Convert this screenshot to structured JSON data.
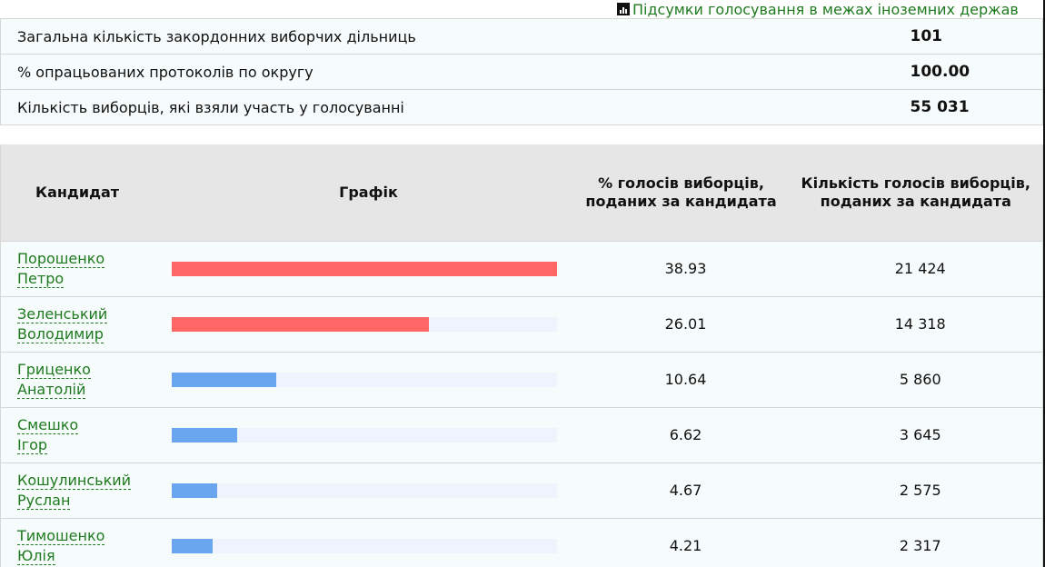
{
  "top_link": {
    "icon": "bar-chart-icon",
    "text": "Підсумки голосування в межах іноземних держав"
  },
  "summary": [
    {
      "label": "Загальна кількість закордонних виборчих дільниць",
      "value": "101"
    },
    {
      "label": "% опрацьованих протоколів по округу",
      "value": "100.00"
    },
    {
      "label": "Кількість виборців, які взяли участь у голосуванні",
      "value": "55 031"
    }
  ],
  "results": {
    "headers": {
      "candidate": "Кандидат",
      "chart": "Графік",
      "percent": "% голосів виборців, поданих за кандидата",
      "count": "Кількість голосів виборців, поданих за кандидата"
    },
    "colors": {
      "top": "#ff6666",
      "other": "#6aa6f0",
      "track": "#eef3fd"
    },
    "rows": [
      {
        "name_line1": "Порошенко",
        "name_line2": "Петро",
        "percent": "38.93",
        "count": "21 424",
        "bar_fraction": 1.0,
        "color": "top"
      },
      {
        "name_line1": "Зеленський",
        "name_line2": "Володимир",
        "percent": "26.01",
        "count": "14 318",
        "bar_fraction": 0.668,
        "color": "top"
      },
      {
        "name_line1": "Гриценко",
        "name_line2": "Анатолій",
        "percent": "10.64",
        "count": "5 860",
        "bar_fraction": 0.273,
        "color": "other"
      },
      {
        "name_line1": "Смешко",
        "name_line2": "Ігор",
        "percent": "6.62",
        "count": "3 645",
        "bar_fraction": 0.17,
        "color": "other"
      },
      {
        "name_line1": "Кошулинський",
        "name_line2": "Руслан",
        "percent": "4.67",
        "count": "2 575",
        "bar_fraction": 0.12,
        "color": "other"
      },
      {
        "name_line1": "Тимошенко",
        "name_line2": "Юлія",
        "percent": "4.21",
        "count": "2 317",
        "bar_fraction": 0.108,
        "color": "other"
      }
    ]
  }
}
